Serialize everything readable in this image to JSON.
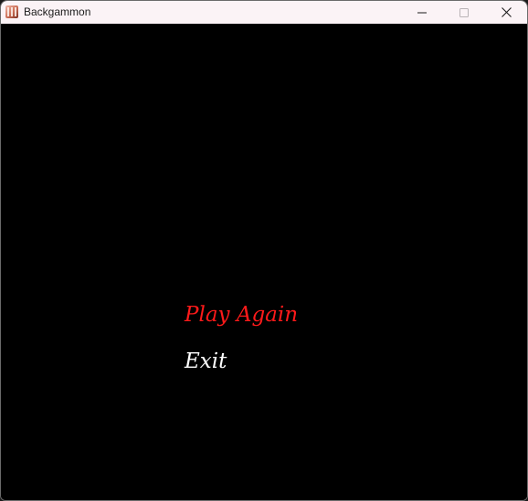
{
  "window": {
    "title": "Backgammon",
    "app_icon": "backgammon-board-icon",
    "controls": {
      "minimize_icon": "minimize-icon",
      "maximize_icon": "maximize-icon",
      "close_icon": "close-icon"
    }
  },
  "menu": {
    "items": [
      {
        "label": "Play Again",
        "color": "#ff1a1a",
        "selected": true
      },
      {
        "label": "Exit",
        "color": "#ffffff",
        "selected": false
      }
    ]
  },
  "colors": {
    "background": "#000000",
    "titlebar": "#fbf3f6",
    "highlight": "#ff1a1a",
    "text": "#ffffff"
  }
}
